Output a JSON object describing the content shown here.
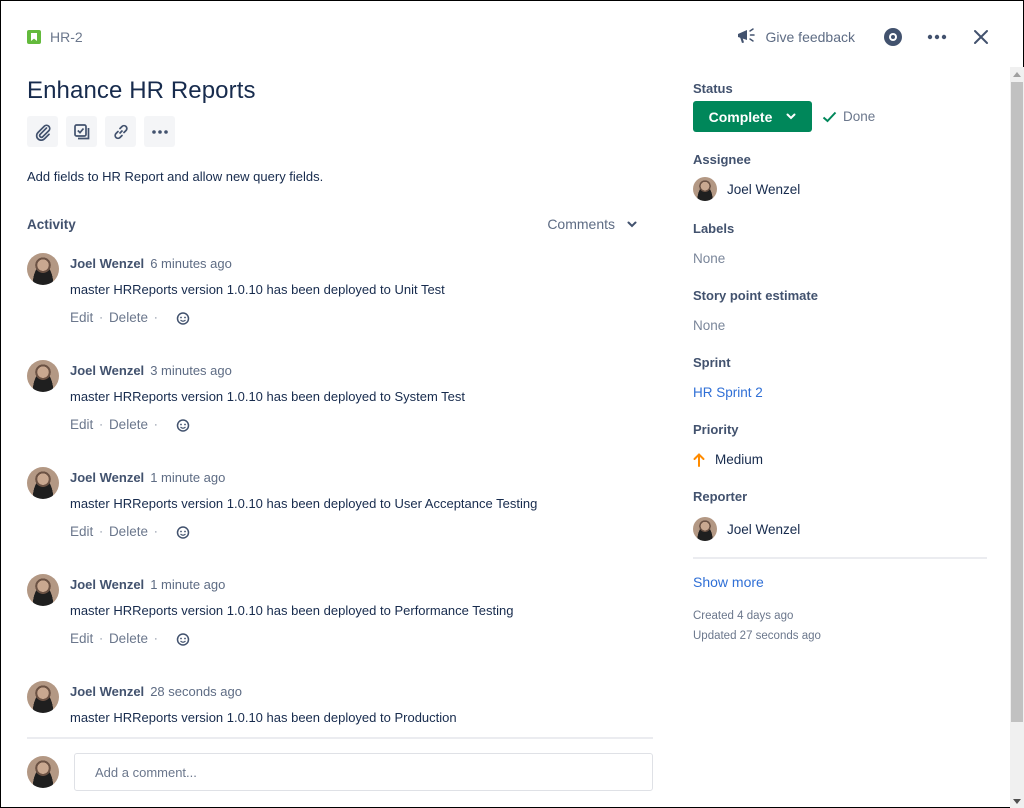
{
  "issue": {
    "key": "HR-2",
    "title": "Enhance HR Reports",
    "description": "Add fields to HR Report and allow new query fields."
  },
  "header_actions": {
    "feedback_label": "Give feedback",
    "icons": [
      "megaphone-icon",
      "eye-icon",
      "more-icon",
      "close-icon"
    ]
  },
  "toolbar": {
    "buttons": [
      "attach",
      "create-subtask",
      "link-issue",
      "more"
    ]
  },
  "activity": {
    "label": "Activity",
    "filter": "Comments",
    "comments": [
      {
        "author": "Joel Wenzel",
        "time": "6 minutes ago",
        "body": "master HRReports version 1.0.10 has been deployed to Unit Test",
        "actions": [
          "Edit",
          "Delete"
        ]
      },
      {
        "author": "Joel Wenzel",
        "time": "3 minutes ago",
        "body": "master HRReports version 1.0.10 has been deployed to System Test",
        "actions": [
          "Edit",
          "Delete"
        ]
      },
      {
        "author": "Joel Wenzel",
        "time": "1 minute ago",
        "body": "master HRReports version 1.0.10 has been deployed to User Acceptance Testing",
        "actions": [
          "Edit",
          "Delete"
        ]
      },
      {
        "author": "Joel Wenzel",
        "time": "1 minute ago",
        "body": "master HRReports version 1.0.10 has been deployed to Performance Testing",
        "actions": [
          "Edit",
          "Delete"
        ]
      },
      {
        "author": "Joel Wenzel",
        "time": "28 seconds ago",
        "body": "master HRReports version 1.0.10 has been deployed to Production"
      }
    ],
    "add_comment_placeholder": "Add a comment..."
  },
  "sidebar": {
    "status": {
      "label": "Status",
      "value": "Complete",
      "resolution": "Done",
      "color": "#00875a"
    },
    "assignee": {
      "label": "Assignee",
      "value": "Joel Wenzel"
    },
    "labels": {
      "label": "Labels",
      "value": "None"
    },
    "story_points": {
      "label": "Story point estimate",
      "value": "None"
    },
    "sprint": {
      "label": "Sprint",
      "value": "HR Sprint 2"
    },
    "priority": {
      "label": "Priority",
      "value": "Medium",
      "color": "#ff8b00"
    },
    "reporter": {
      "label": "Reporter",
      "value": "Joel Wenzel"
    },
    "show_more": "Show more",
    "created": "Created 4 days ago",
    "updated": "Updated 27 seconds ago"
  }
}
